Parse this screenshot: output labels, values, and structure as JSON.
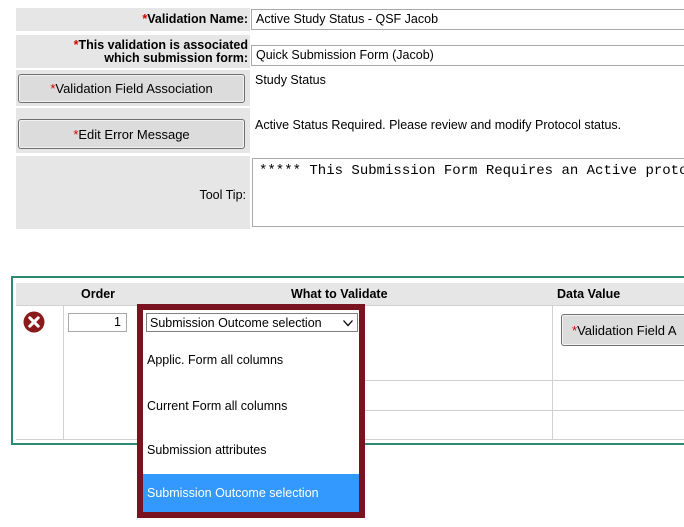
{
  "form": {
    "validation_name": {
      "label": "Validation Name:",
      "value": "Active Study Status - QSF Jacob"
    },
    "submission_form": {
      "label_line1": "This validation is associated",
      "label_line2": "which submission form:",
      "value": "Quick Submission Form (Jacob)"
    },
    "field_association": {
      "button_label": "Validation Field Association",
      "value": "Study Status"
    },
    "error_message": {
      "button_label": "Edit Error Message",
      "value": "Active Status Required. Please review and modify Protocol status."
    },
    "tool_tip": {
      "label": "Tool Tip:",
      "value": "***** This Submission Form Requires an Active proto"
    },
    "required_marker": "*"
  },
  "grid": {
    "headers": {
      "order": "Order",
      "what": "What to Validate",
      "data_value": "Data Value"
    },
    "row": {
      "order": "1",
      "what_selected": "Submission Outcome selection",
      "data_value_button": "Validation Field A"
    }
  },
  "dropdown": {
    "options": [
      "Applic. Form all columns",
      "Current Form all columns",
      "Submission attributes",
      "Submission Outcome selection"
    ],
    "highlighted_index": 3,
    "highlight_color": "#3399ff",
    "border_color": "#7a1320"
  }
}
